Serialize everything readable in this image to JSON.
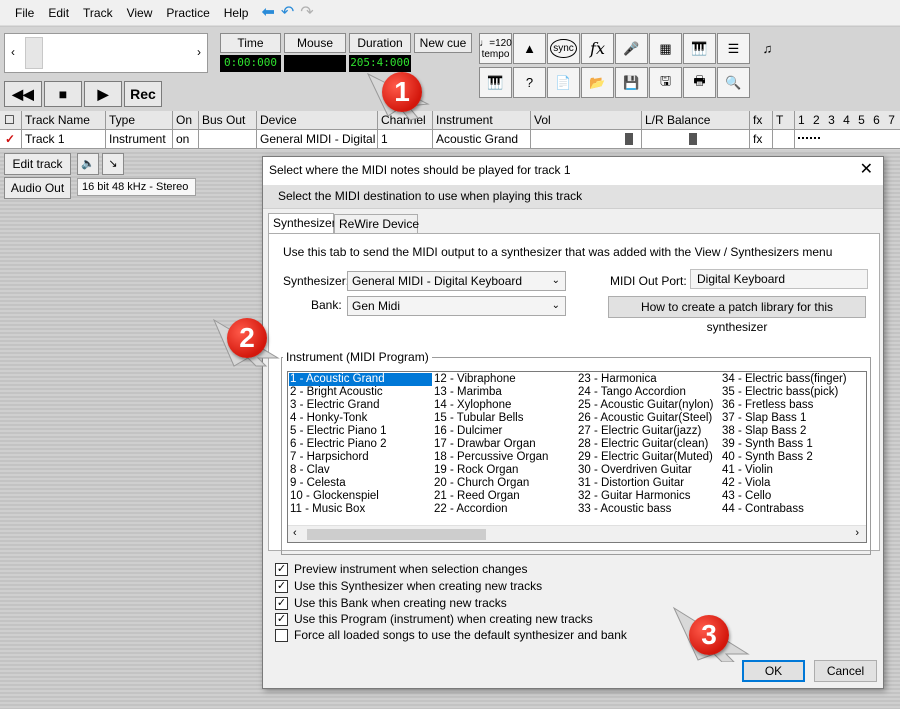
{
  "menu": [
    "File",
    "Edit",
    "Track",
    "View",
    "Practice",
    "Help"
  ],
  "toolbar": {
    "time_label": "Time",
    "time_value": "0:00:000",
    "mouse_label": "Mouse",
    "duration_label": "Duration",
    "duration_value": "205:4:000",
    "newcue_label": "New cue",
    "tempo_label": "♩=120",
    "tempo_sub": "tempo",
    "sync_label": "sync",
    "fx_label": "fx",
    "rec_label": "Rec"
  },
  "track_header": {
    "columns": [
      "Track Name",
      "Type",
      "On",
      "Bus Out",
      "Device",
      "Channel",
      "Instrument",
      "Vol",
      "L/R Balance",
      "fx",
      "T",
      "1",
      "2",
      "3",
      "4",
      "5",
      "6",
      "7"
    ]
  },
  "track_row": {
    "name": "Track 1",
    "type": "Instrument",
    "on": "on",
    "bus_out": "",
    "device": "General MIDI - Digital Keyboard",
    "channel": "1",
    "instrument": "Acoustic Grand",
    "fx": "fx"
  },
  "side": {
    "edit_track": "Edit track",
    "audio_out": "Audio Out",
    "audio_format": "16 bit 48 kHz - Stereo"
  },
  "dialog": {
    "title": "Select where the MIDI notes should be played for track 1",
    "description": "Select the MIDI destination to use when playing this track",
    "tabs": [
      "Synthesizer",
      "ReWire Device"
    ],
    "intro": "Use this tab to send the MIDI output to a synthesizer that was added with the View / Synthesizers menu",
    "synth_label": "Synthesizer:",
    "synth_value": "General MIDI - Digital Keyboard",
    "bank_label": "Bank:",
    "bank_value": "Gen Midi",
    "out_port_label": "MIDI Out Port:",
    "out_port_value": "Digital Keyboard",
    "patch_btn": "How to create a patch library for this synthesizer",
    "group_title": "Instrument (MIDI Program)",
    "instruments": [
      [
        "1 - Acoustic Grand",
        "2 - Bright Acoustic",
        "3 - Electric Grand",
        "4 - Honky-Tonk",
        "5 - Electric Piano 1",
        "6 - Electric Piano 2",
        "7 - Harpsichord",
        "8 - Clav",
        "9 - Celesta",
        "10 - Glockenspiel",
        "11 - Music Box"
      ],
      [
        "12 - Vibraphone",
        "13 - Marimba",
        "14 - Xylophone",
        "15 - Tubular Bells",
        "16 - Dulcimer",
        "17 - Drawbar Organ",
        "18 - Percussive Organ",
        "19 - Rock Organ",
        "20 - Church Organ",
        "21 - Reed Organ",
        "22 - Accordion"
      ],
      [
        "23 - Harmonica",
        "24 - Tango Accordion",
        "25 - Acoustic Guitar(nylon)",
        "26 - Acoustic Guitar(Steel)",
        "27 - Electric Guitar(jazz)",
        "28 - Electric Guitar(clean)",
        "29 - Electric Guitar(Muted)",
        "30 - Overdriven Guitar",
        "31 - Distortion Guitar",
        "32 - Guitar Harmonics",
        "33 - Acoustic bass"
      ],
      [
        "34 - Electric bass(finger)",
        "35 - Electric bass(pick)",
        "36 - Fretless bass",
        "37 - Slap Bass 1",
        "38 - Slap Bass 2",
        "39 - Synth Bass 1",
        "40 - Synth Bass 2",
        "41 - Violin",
        "42 - Viola",
        "43 - Cello",
        "44 - Contrabass"
      ]
    ],
    "options": [
      {
        "label": "Preview instrument when selection changes",
        "checked": true
      },
      {
        "label": "Use this Synthesizer when creating new tracks",
        "checked": true
      },
      {
        "label": "Use this Bank when creating new tracks",
        "checked": true
      },
      {
        "label": "Use this Program (instrument) when creating new tracks",
        "checked": true
      },
      {
        "label": "Force all loaded songs to use the default synthesizer and bank",
        "checked": false
      }
    ],
    "ok": "OK",
    "cancel": "Cancel"
  },
  "badges": [
    "1",
    "2",
    "3"
  ]
}
